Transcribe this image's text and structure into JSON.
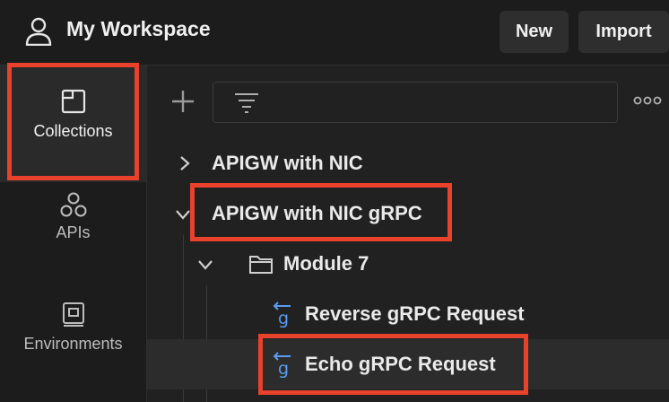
{
  "header": {
    "workspace_title": "My Workspace",
    "new_label": "New",
    "import_label": "Import"
  },
  "sidebar": {
    "items": [
      {
        "label": "Collections",
        "icon": "collections-icon",
        "active": true
      },
      {
        "label": "APIs",
        "icon": "apis-icon",
        "active": false
      },
      {
        "label": "Environments",
        "icon": "environments-icon",
        "active": false
      }
    ]
  },
  "toolbar": {
    "add_icon": "plus-icon",
    "filter_icon": "filter-icon",
    "more_icon": "more-options-icon"
  },
  "tree": [
    {
      "label": "APIGW with NIC",
      "type": "collection",
      "expanded": false
    },
    {
      "label": "APIGW with NIC gRPC",
      "type": "collection",
      "expanded": true
    },
    {
      "label": "Module 7",
      "type": "folder",
      "expanded": true
    },
    {
      "label": "Reverse gRPC Request",
      "type": "grpc-request"
    },
    {
      "label": "Echo gRPC Request",
      "type": "grpc-request",
      "selected": true
    }
  ],
  "colors": {
    "highlight": "#e8412c",
    "grpc_icon": "#5b9cf0",
    "background": "#212121"
  }
}
